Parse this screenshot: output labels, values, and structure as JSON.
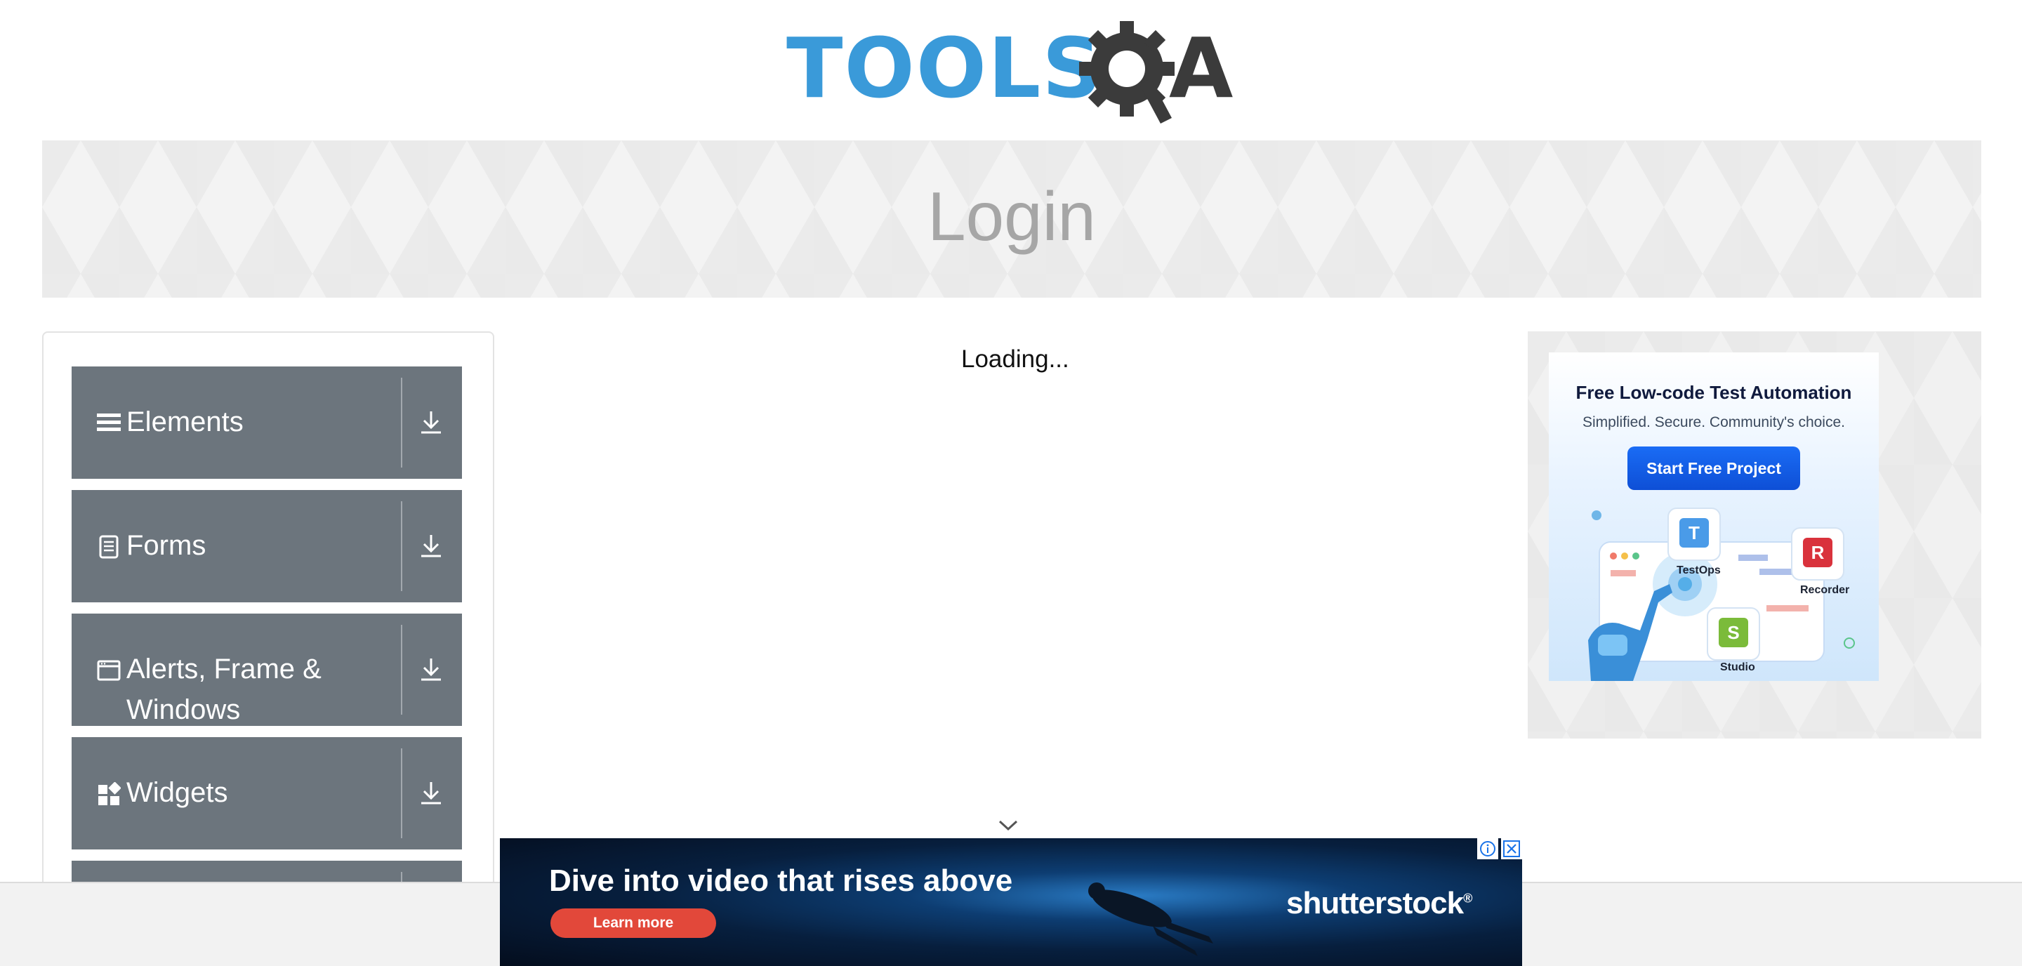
{
  "header": {
    "logo_text": "TOOLS",
    "logo_text_suffix": "A",
    "logo_alt": "TOOLSQA"
  },
  "banner": {
    "title": "Login"
  },
  "sidebar": {
    "groups": [
      {
        "label": "Elements",
        "icon": "list-icon"
      },
      {
        "label": "Forms",
        "icon": "document-icon"
      },
      {
        "label": "Alerts, Frame & Windows",
        "label_line1": "Alerts, Frame &",
        "label_line2": "Windows",
        "icon": "window-icon"
      },
      {
        "label": "Widgets",
        "icon": "widgets-icon"
      }
    ]
  },
  "main": {
    "loading_text": "Loading..."
  },
  "right_ad": {
    "title": "Free Low-code Test Automation",
    "subtitle": "Simplified. Secure. Community's choice.",
    "cta": "Start Free Project",
    "products": [
      "TestOps",
      "Recorder",
      "Studio"
    ]
  },
  "bottom_ad": {
    "headline": "Dive into video that rises above",
    "cta": "Learn more",
    "brand": "shutterstock",
    "brand_mark": "®"
  },
  "colors": {
    "logo_blue": "#3a9ad9",
    "logo_dark": "#3b3b3b",
    "sidebar_group_bg": "#6c757d",
    "ad_button_blue": "#1a6cf5",
    "learn_more_red": "#e2483a"
  }
}
